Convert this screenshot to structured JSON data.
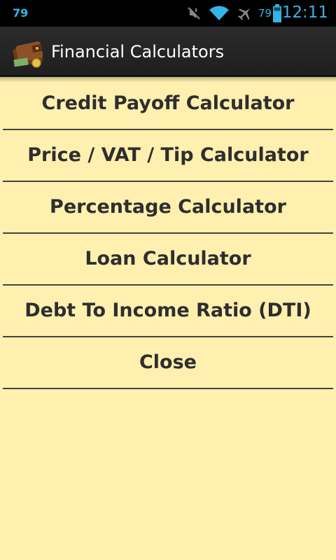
{
  "status_bar": {
    "notification_count": "79",
    "battery_percent": "79",
    "time": "12:11",
    "icons": [
      "mute-icon",
      "wifi-icon",
      "airplane-icon",
      "battery-icon"
    ],
    "accent_color": "#33b5e5"
  },
  "action_bar": {
    "title": "Financial Calculators",
    "icon": "wallet-icon"
  },
  "menu": {
    "items": [
      {
        "label": "Credit Payoff Calculator"
      },
      {
        "label": "Price / VAT / Tip Calculator"
      },
      {
        "label": "Percentage Calculator"
      },
      {
        "label": "Loan Calculator"
      },
      {
        "label": "Debt To Income Ratio (DTI)"
      },
      {
        "label": "Close"
      }
    ]
  },
  "colors": {
    "background": "#fff0b0",
    "text": "#2e2e2e",
    "divider": "#444444"
  }
}
